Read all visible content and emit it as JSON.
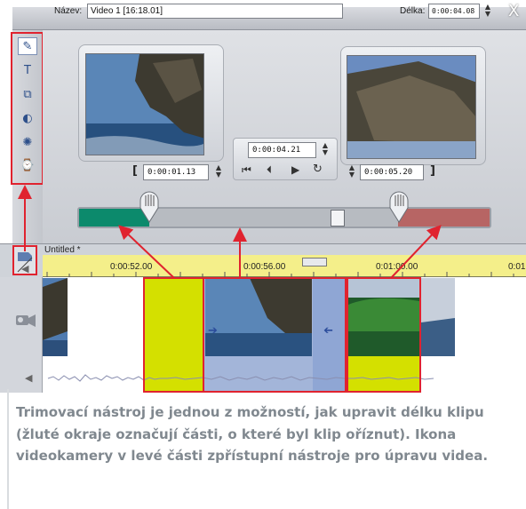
{
  "window": {
    "name_label": "Název:",
    "name_value": "Video 1 [16:18.01]",
    "duration_label": "Délka:",
    "duration_value": "0:00:04.08",
    "close_glyph": "X"
  },
  "tools": [
    {
      "icon": "edit-video-properties-icon",
      "glyph": "✎"
    },
    {
      "icon": "titles-icon",
      "glyph": "T"
    },
    {
      "icon": "transitions-icon",
      "glyph": "⧉"
    },
    {
      "icon": "audio-icon",
      "glyph": "◐"
    },
    {
      "icon": "effects-icon",
      "glyph": "✺"
    },
    {
      "icon": "speed-icon",
      "glyph": "⌚"
    }
  ],
  "trim": {
    "in_timecode": "0:00:01.13",
    "center_timecode": "0:00:04.21",
    "out_timecode": "0:00:05.20",
    "bracket_open": "[",
    "bracket_close": "]"
  },
  "timeline": {
    "project_title": "Untitled *",
    "ruler_ticks": [
      "0:00:52.00",
      "0:00:56.00",
      "0:01:00.00",
      "0:01"
    ]
  },
  "caption": "Trimovací nástroj je jednou z možností, jak upravit délku klipu (žluté okraje označují části, o které byl klip oříznut). Ikona videokamery v levé části zpřístupní nástroje pro úpravu videa.",
  "colors": {
    "trim_green": "#0c8a6c",
    "trim_red": "#b76564",
    "trimmed_yellow": "#d4e000",
    "clip_blue": "#a3b5d9",
    "highlight_red": "#e0232f"
  }
}
